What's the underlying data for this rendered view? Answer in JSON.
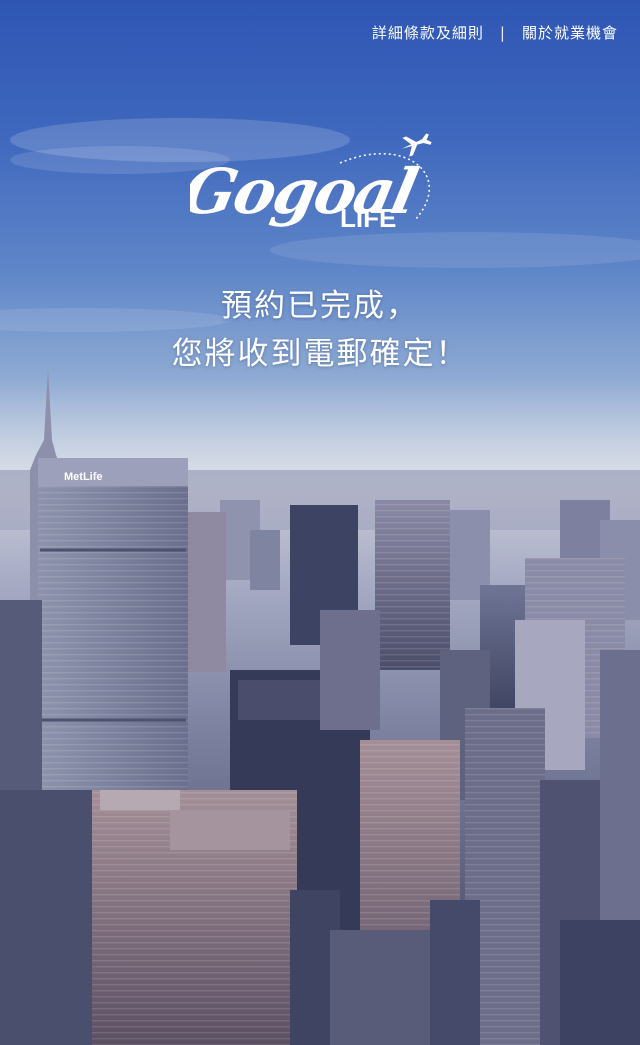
{
  "nav": {
    "terms_label": "詳細條款及細則",
    "separator": "|",
    "careers_label": "關於就業機會"
  },
  "logo": {
    "script_text": "Gogoal",
    "life_text": "LIFE",
    "icon": "airplane-icon"
  },
  "message": {
    "line1": "預約已完成，",
    "line2": "您將收到電郵確定！"
  },
  "background": {
    "scene": "city-skyline-photo",
    "building_sign": "MetLife"
  },
  "colors": {
    "sky_top": "#2f56b4",
    "haze": "#c9cbd8",
    "city": "#4a4f6e",
    "text": "#ffffff"
  }
}
